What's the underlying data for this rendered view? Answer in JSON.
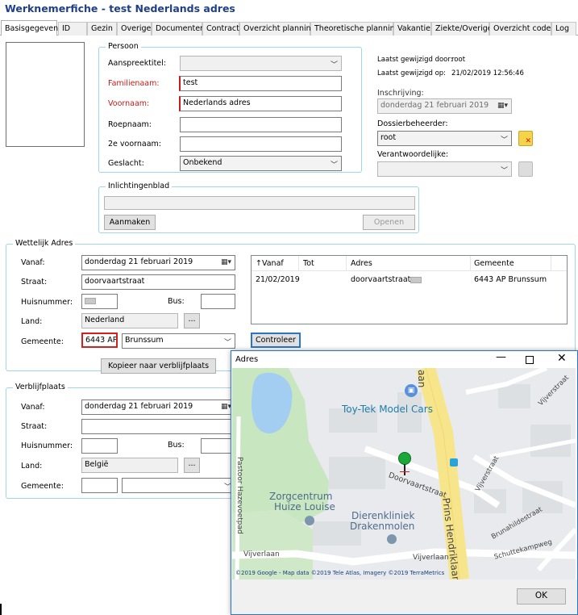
{
  "window_title": "Werknemerfiche - test Nederlands adres",
  "tabs": [
    "Basisgegevens",
    "ID",
    "Gezin",
    "Overige",
    "Documenten",
    "Contract",
    "Overzicht planning",
    "Theoretische planning",
    "Vakantie",
    "Ziekte/Overige",
    "Overzicht codes",
    "Log"
  ],
  "persoon": {
    "group_title": "Persoon",
    "aanspreektitel_label": "Aanspreektitel:",
    "familienaam_label": "Familienaam:",
    "familienaam_value": "test",
    "voornaam_label": "Voornaam:",
    "voornaam_value": "Nederlands adres",
    "roepnaam_label": "Roepnaam:",
    "tweede_voornaam_label": "2e voornaam:",
    "geslacht_label": "Geslacht:",
    "geslacht_value": "Onbekend"
  },
  "meta": {
    "laatst_door_label": "Laatst gewijzigd door:",
    "laatst_door_value": "root",
    "laatst_op_label": "Laatst gewijzigd op:",
    "laatst_op_value": "21/02/2019 12:56:46",
    "inschrijving_label": "Inschrijving:",
    "inschrijving_value": "donderdag 21  februari  2019",
    "dossierbeheerder_label": "Dossierbeheerder:",
    "dossierbeheerder_value": "root",
    "verantwoordelijke_label": "Verantwoordelijke:"
  },
  "inlichtingenblad": {
    "title": "Inlichtingenblad",
    "aanmaken": "Aanmaken",
    "openen": "Openen"
  },
  "wettelijk": {
    "title": "Wettelijk Adres",
    "vanaf_label": "Vanaf:",
    "vanaf_value": "donderdag 21  februari  2019",
    "straat_label": "Straat:",
    "straat_value": "doorvaartstraat",
    "huisnummer_label": "Huisnummer:",
    "bus_label": "Bus:",
    "land_label": "Land:",
    "land_value": "Nederland",
    "gemeente_label": "Gemeente:",
    "postcode_value": "6443 AP",
    "gemeente_value": "Brunssum",
    "kopieer_button": "Kopieer naar verblijfplaats",
    "controleer_button": "Controleer",
    "ellipsis": "..."
  },
  "history_table": {
    "columns": [
      "↑Vanaf",
      "Tot",
      "Adres",
      "Gemeente"
    ],
    "rows": [
      {
        "vanaf": "21/02/2019",
        "tot": "",
        "adres": "doorvaartstraat",
        "gemeente": "6443 AP Brunssum"
      }
    ]
  },
  "verblijfplaats": {
    "title": "Verblijfplaats",
    "vanaf_label": "Vanaf:",
    "vanaf_value": "donderdag 21  februari  2019",
    "straat_label": "Straat:",
    "huisnummer_label": "Huisnummer:",
    "bus_label": "Bus:",
    "land_label": "Land:",
    "land_value": "België",
    "gemeente_label": "Gemeente:",
    "ellipsis": "..."
  },
  "adres_dialog": {
    "title": "Adres",
    "ok_button": "OK",
    "map_labels": {
      "toy": "Toy-Tek Model Cars",
      "zorg1": "Zorgcentrum",
      "zorg2": "Huize Louise",
      "dier1": "Dierenkliniek",
      "dier2": "Drakenmolen",
      "prins": "Prins Hendriklaan",
      "pastoor": "Pastoor Hazevoetpad",
      "vijverlaan": "Vijverlaan",
      "vijverlaan2": "Vijverlaan",
      "doorvaart": "Doorvaartstraat",
      "brunahilde": "Brunahildestraat",
      "schutte": "Schuttekampweg",
      "vijverstraat": "Vijverstraat",
      "vijverstraat2": "Vijverstraat",
      "aan": "aan",
      "copyright": "©2019 Google - Map data ©2019 Tele Atlas, Imagery ©2019 TerraMetrics"
    }
  }
}
